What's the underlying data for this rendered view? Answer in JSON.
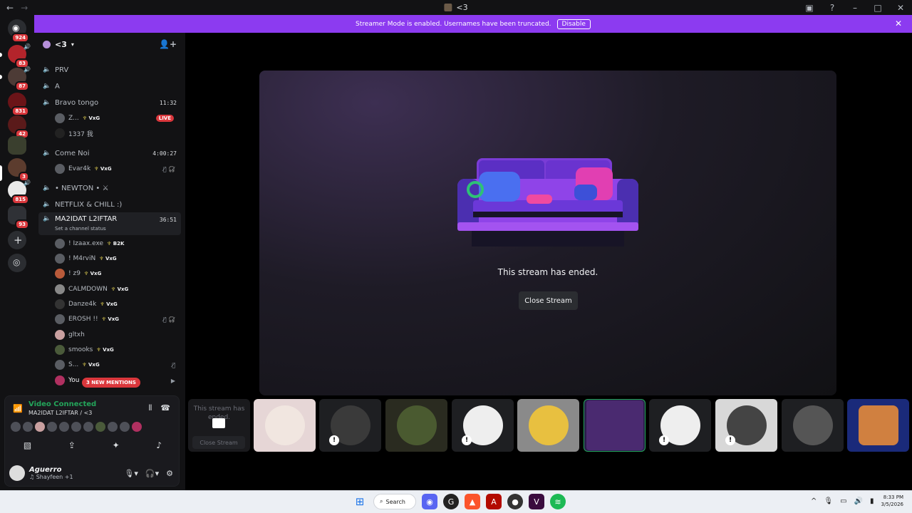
{
  "titlebar": {
    "title": "<3"
  },
  "banner": {
    "text": "Streamer Mode is enabled. Usernames have been truncated.",
    "disable_label": "Disable"
  },
  "guild_badges": [
    "924",
    "83",
    "87",
    "831",
    "42",
    "3",
    "815",
    "93"
  ],
  "server": {
    "name": "<3"
  },
  "channels": [
    {
      "name": "PRV",
      "time": ""
    },
    {
      "name": "A",
      "time": ""
    },
    {
      "name": "Bravo tongo",
      "time": "11:32"
    },
    {
      "name": "Come Noi",
      "time": "4:00:27"
    },
    {
      "name": "• NEWTON • ⚔",
      "time": ""
    },
    {
      "name": "NETFLIX & CHILL :)",
      "time": ""
    },
    {
      "name": "MA2IDAT L2IFTAR",
      "time": "36:51",
      "status": "Set a channel status"
    }
  ],
  "users": {
    "bravo": [
      {
        "name": "Z...",
        "tag": "VxG",
        "live": "LIVE"
      },
      {
        "name": "1337 我",
        "tag": ""
      }
    ],
    "comenoi": [
      {
        "name": "Evar4k",
        "tag": "VxG"
      }
    ],
    "ma2idat": [
      {
        "name": "! Izaax.exe",
        "tag": "B2K"
      },
      {
        "name": "! M4rviN",
        "tag": "VxG"
      },
      {
        "name": "! z9",
        "tag": "VxG"
      },
      {
        "name": "CALMDOWN",
        "tag": "VxG"
      },
      {
        "name": "Danze4k",
        "tag": "VxG"
      },
      {
        "name": "EROSH !!",
        "tag": "VxG"
      },
      {
        "name": "gltxh",
        "tag": ""
      },
      {
        "name": "smooks",
        "tag": "VxG"
      },
      {
        "name": "S...",
        "tag": "VxG"
      },
      {
        "name": "You",
        "tag": ""
      }
    ]
  },
  "mentions_label": "3 NEW MENTIONS",
  "voice": {
    "title": "Video Connected",
    "sub": "MA2IDAT L2IFTAR / <3"
  },
  "me": {
    "name": "Aguerro",
    "status": "♫ Shayfeen +1"
  },
  "stream": {
    "ended_text": "This stream has ended.",
    "close_label": "Close Stream"
  },
  "tile0": {
    "text": "This stream has ended.",
    "close_label": "Close Stream"
  },
  "taskbar": {
    "search_label": "Search",
    "time": "8:33 PM",
    "date": "3/5/2026"
  },
  "colors": {
    "accent": "#8c3bf0",
    "live": "#da373c",
    "connected": "#23a55a"
  }
}
